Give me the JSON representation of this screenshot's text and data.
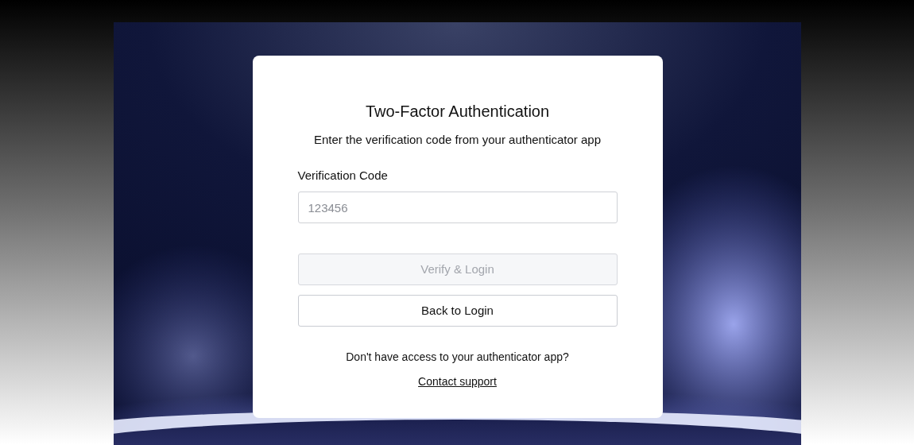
{
  "card": {
    "title": "Two-Factor Authentication",
    "subtitle": "Enter the verification code from your authenticator app",
    "field": {
      "label": "Verification Code",
      "placeholder": "123456"
    },
    "buttons": [
      {
        "label": "Verify & Login",
        "disabled": true
      },
      {
        "label": "Back to Login",
        "disabled": false
      }
    ],
    "help_text": "Don't have access to your authenticator app?",
    "link": "Contact support"
  }
}
